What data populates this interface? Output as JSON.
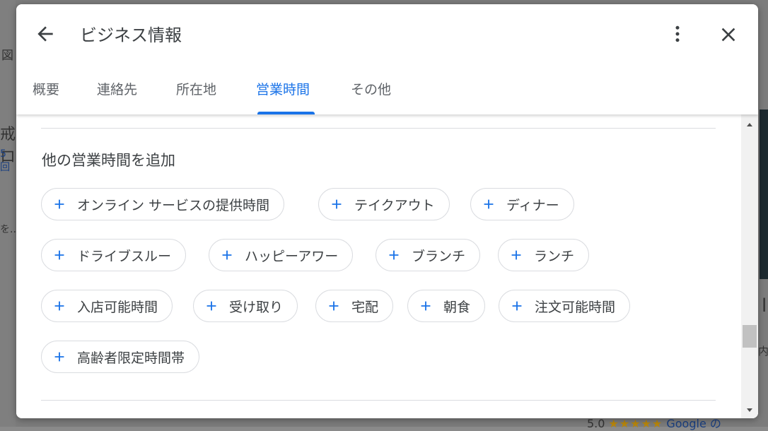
{
  "background": {
    "left_snippets": [
      "図",
      "戒ロ",
      "5 回",
      "を..."
    ],
    "right_snippets": [
      "l",
      "内"
    ],
    "bottom_rating": "5.0",
    "bottom_stars": "★★★★★",
    "bottom_link": "Google の"
  },
  "dialog": {
    "title": "ビジネス情報",
    "tabs": [
      {
        "label": "概要",
        "active": false
      },
      {
        "label": "連絡先",
        "active": false
      },
      {
        "label": "所在地",
        "active": false
      },
      {
        "label": "営業時間",
        "active": true
      },
      {
        "label": "その他",
        "active": false
      }
    ],
    "section_title": "他の営業時間を追加",
    "chips": [
      "オンライン サービスの提供時間",
      "テイクアウト",
      "ディナー",
      "ドライブスルー",
      "ハッピーアワー",
      "ブランチ",
      "ランチ",
      "入店可能時間",
      "受け取り",
      "宅配",
      "朝食",
      "注文可能時間",
      "高齢者限定時間帯"
    ]
  },
  "icons": {
    "back": "arrow-left-icon",
    "more": "more-vert-icon",
    "close": "close-icon",
    "chip_plus": "plus-icon",
    "scroll_up": "triangle-up-icon",
    "scroll_down": "triangle-down-icon"
  },
  "colors": {
    "accent": "#1a73e8",
    "text": "#3c4043",
    "secondary_text": "#5f6368",
    "chip_border": "#dadce0",
    "overlay": "#7c7c7c"
  }
}
